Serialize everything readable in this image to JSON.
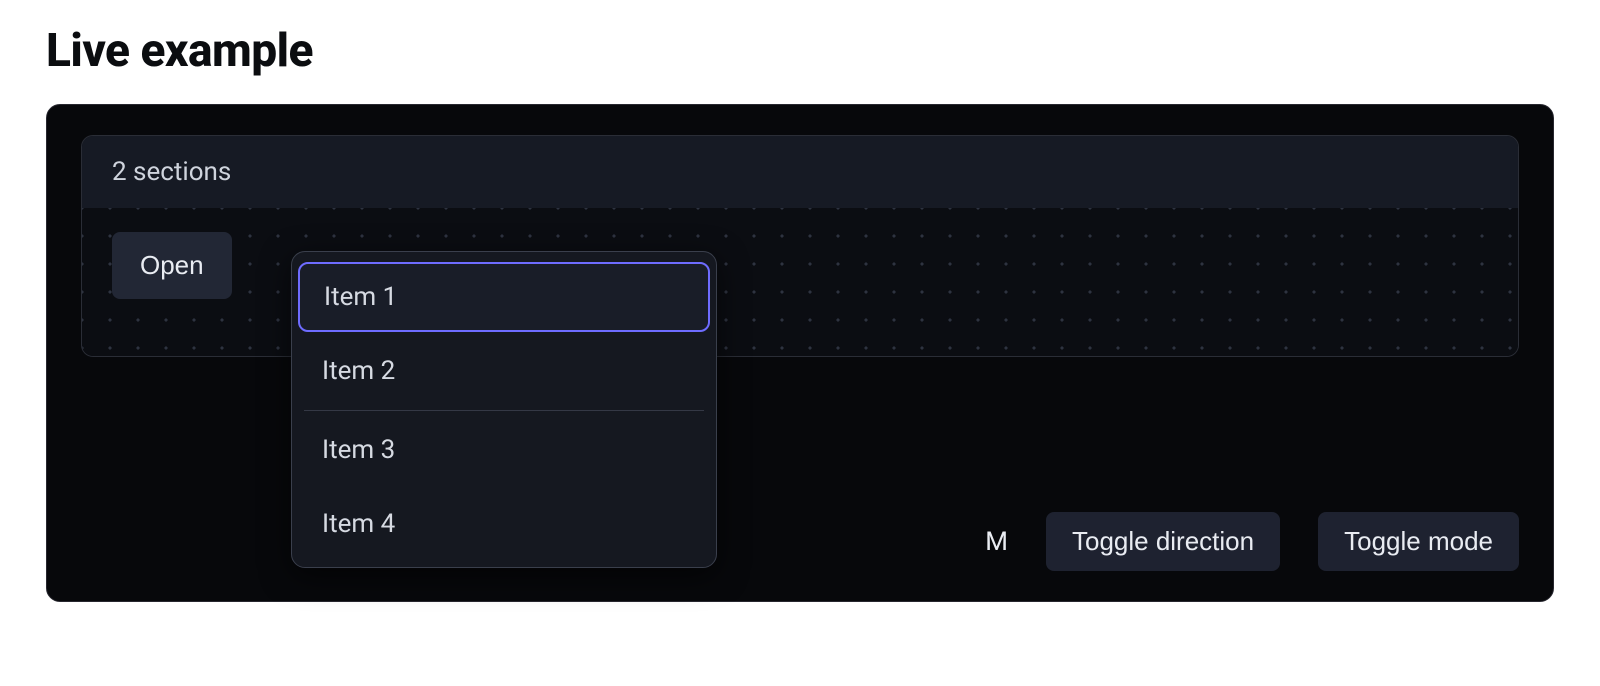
{
  "heading": "Live example",
  "section": {
    "title": "2 sections",
    "open_button_label": "Open"
  },
  "menu": {
    "items": [
      {
        "label": "Item 1",
        "focused": true
      },
      {
        "label": "Item 2",
        "focused": false
      },
      {
        "label": "Item 3",
        "focused": false
      },
      {
        "label": "Item 4",
        "focused": false
      }
    ],
    "separator_after_index": 1
  },
  "footer": {
    "size_label": "M",
    "toggle_direction_label": "Toggle direction",
    "toggle_mode_label": "Toggle mode"
  }
}
